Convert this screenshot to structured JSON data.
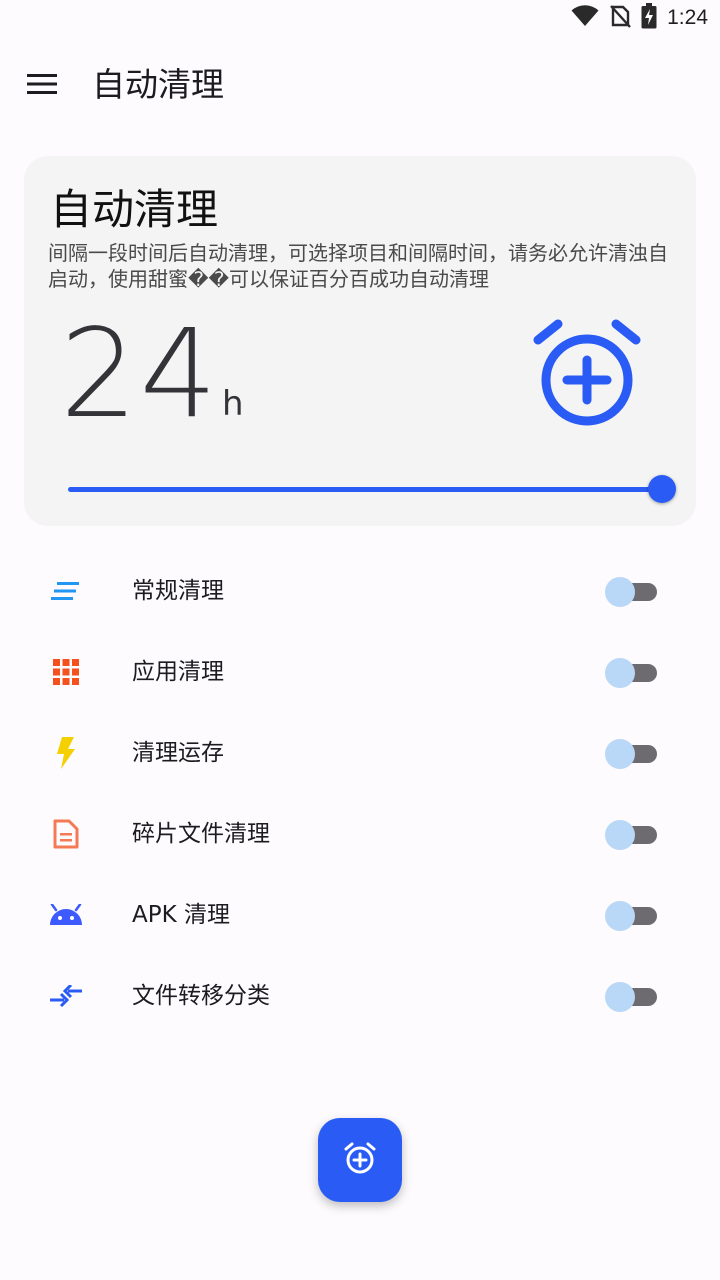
{
  "status_bar": {
    "time": "1:24",
    "icons": [
      "wifi-icon",
      "no-sim-icon",
      "battery-charging-icon"
    ]
  },
  "app_bar": {
    "title": "自动清理",
    "menu_icon": "hamburger-menu-icon"
  },
  "card": {
    "title": "自动清理",
    "description": "间隔一段时间后自动清理，可选择项目和间隔时间，请务必允许清浊自启动，使用甜蜜��可以保证百分百成功自动清理",
    "interval_value": "24",
    "interval_unit": "h",
    "slider_fraction": 1.0,
    "alarm_icon": "alarm-add-icon"
  },
  "items": [
    {
      "label": "常规清理",
      "icon": "sort-lines-icon",
      "icon_color": "#2196f3",
      "enabled": false
    },
    {
      "label": "应用清理",
      "icon": "apps-grid-icon",
      "icon_color": "#f4511e",
      "enabled": false
    },
    {
      "label": "清理运存",
      "icon": "lightning-bolt-icon",
      "icon_color": "#f5d000",
      "enabled": false
    },
    {
      "label": "碎片文件清理",
      "icon": "document-icon",
      "icon_color": "#f47a55",
      "enabled": false
    },
    {
      "label": "APK 清理",
      "icon": "android-icon",
      "icon_color": "#3d5afe",
      "enabled": false
    },
    {
      "label": "文件转移分类",
      "icon": "swap-arrows-icon",
      "icon_color": "#2a5cf5",
      "enabled": false
    }
  ],
  "fab": {
    "icon": "alarm-add-icon"
  },
  "colors": {
    "accent": "#2a5cf5",
    "card_bg": "#f3f4f3",
    "toggle_thumb": "#b9d7f7",
    "toggle_track": "#6d6a70"
  }
}
